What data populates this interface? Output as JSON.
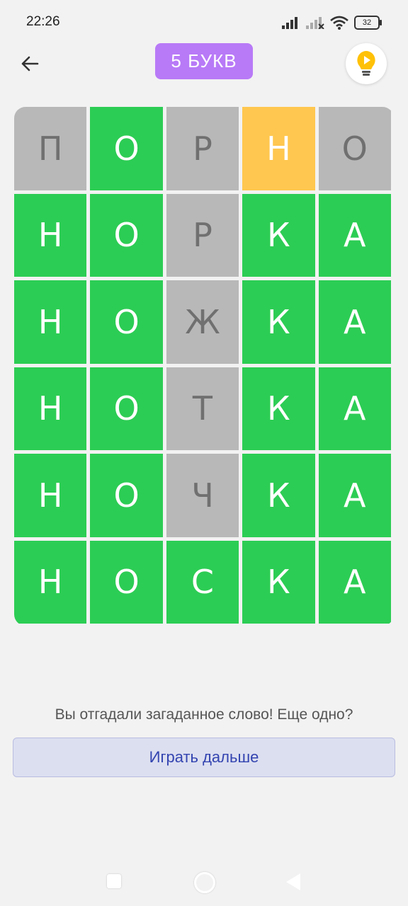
{
  "status_bar": {
    "time": "22:26",
    "battery": "32"
  },
  "header": {
    "title": "5 БУКВ",
    "back_icon": "arrow-left-icon",
    "hint_icon": "lightbulb-play-icon"
  },
  "colors": {
    "correct": "#2ccd54",
    "absent": "#b8b8b8",
    "present": "#ffc74f",
    "badge": "#b87af7"
  },
  "board": {
    "rows": [
      [
        {
          "letter": "П",
          "state": "absent"
        },
        {
          "letter": "О",
          "state": "correct"
        },
        {
          "letter": "Р",
          "state": "absent"
        },
        {
          "letter": "Н",
          "state": "present"
        },
        {
          "letter": "О",
          "state": "absent"
        }
      ],
      [
        {
          "letter": "Н",
          "state": "correct"
        },
        {
          "letter": "О",
          "state": "correct"
        },
        {
          "letter": "Р",
          "state": "absent"
        },
        {
          "letter": "К",
          "state": "correct"
        },
        {
          "letter": "А",
          "state": "correct"
        }
      ],
      [
        {
          "letter": "Н",
          "state": "correct"
        },
        {
          "letter": "О",
          "state": "correct"
        },
        {
          "letter": "Ж",
          "state": "absent"
        },
        {
          "letter": "К",
          "state": "correct"
        },
        {
          "letter": "А",
          "state": "correct"
        }
      ],
      [
        {
          "letter": "Н",
          "state": "correct"
        },
        {
          "letter": "О",
          "state": "correct"
        },
        {
          "letter": "Т",
          "state": "absent"
        },
        {
          "letter": "К",
          "state": "correct"
        },
        {
          "letter": "А",
          "state": "correct"
        }
      ],
      [
        {
          "letter": "Н",
          "state": "correct"
        },
        {
          "letter": "О",
          "state": "correct"
        },
        {
          "letter": "Ч",
          "state": "absent"
        },
        {
          "letter": "К",
          "state": "correct"
        },
        {
          "letter": "А",
          "state": "correct"
        }
      ],
      [
        {
          "letter": "Н",
          "state": "correct"
        },
        {
          "letter": "О",
          "state": "correct"
        },
        {
          "letter": "С",
          "state": "correct"
        },
        {
          "letter": "К",
          "state": "correct"
        },
        {
          "letter": "А",
          "state": "correct"
        }
      ]
    ]
  },
  "result": {
    "message": "Вы отгадали загаданное слово! Еще одно?",
    "button_label": "Играть дальше"
  }
}
